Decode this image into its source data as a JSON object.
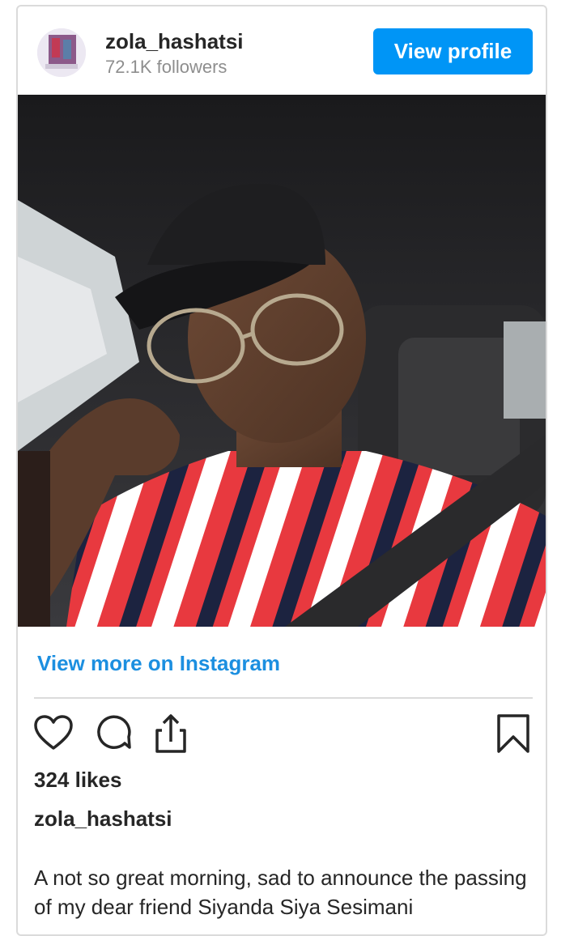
{
  "post": {
    "username": "zola_hashatsi",
    "followers": "72.1K followers",
    "view_profile_label": "View profile",
    "view_more_label": "View more on Instagram",
    "likes": "324 likes",
    "caption_user": "zola_hashatsi",
    "caption_text": "A not so great morning, sad to announce the passing of my dear friend Siyanda Siya Sesimani"
  },
  "icons": {
    "like": "heart-icon",
    "comment": "comment-icon",
    "share": "share-icon",
    "save": "bookmark-icon"
  },
  "colors": {
    "accent": "#0095f6",
    "link": "#1c8fe0",
    "text": "#262626",
    "muted": "#8e8e8e",
    "border": "#dbdbdb"
  }
}
